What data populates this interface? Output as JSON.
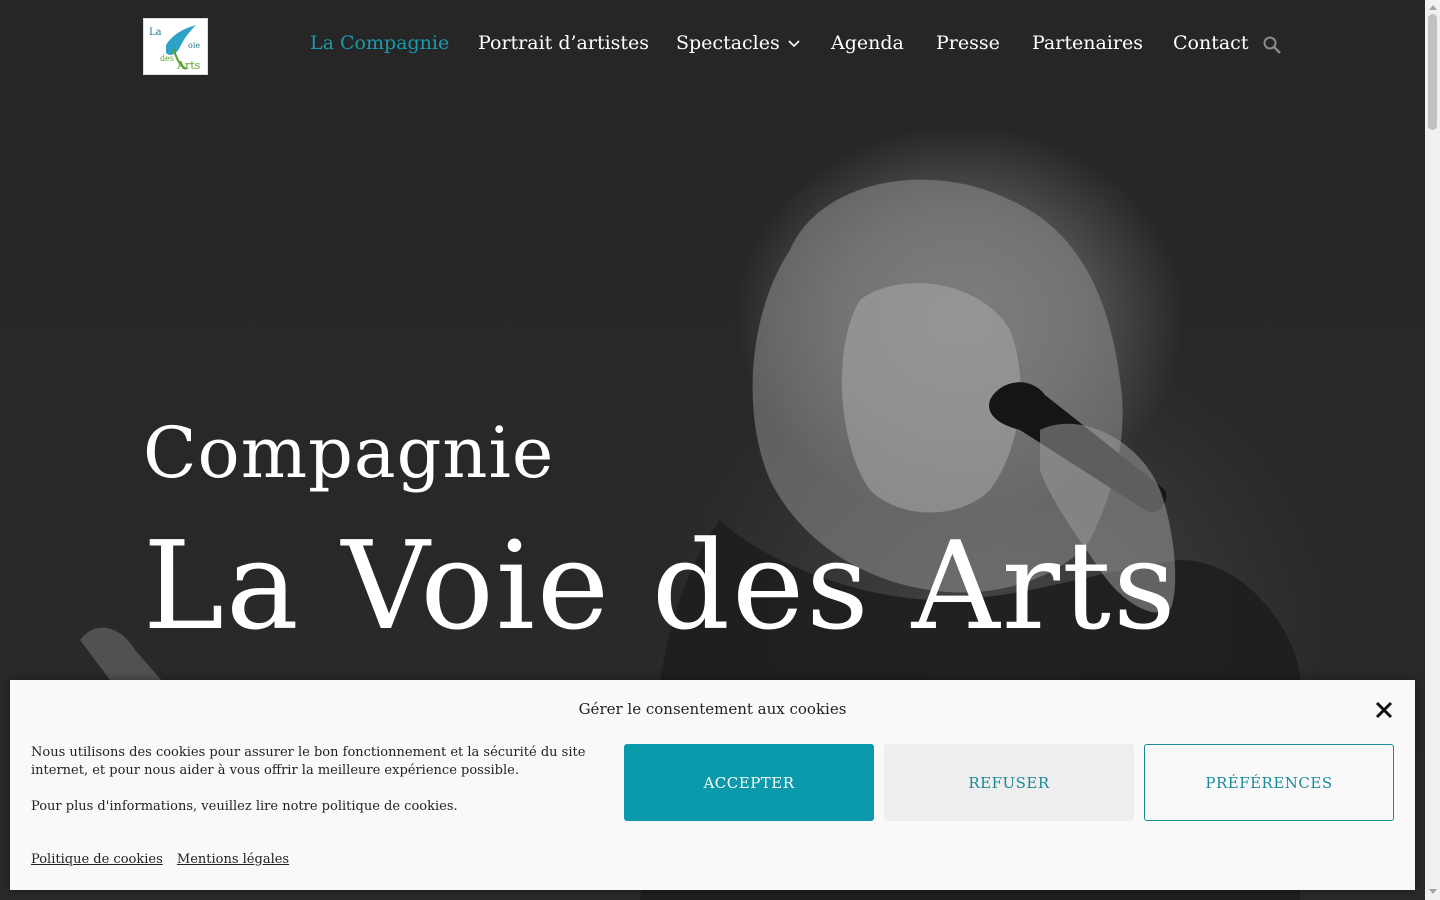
{
  "colors": {
    "accent": "#0a9aab",
    "nav_active": "#1a9aa8",
    "hero_bg": "#252525",
    "text_on_dark": "#ffffff",
    "banner_bg": "#f9f9f9"
  },
  "header": {
    "logo": {
      "line1": "La",
      "line2": "oie",
      "line3": "des",
      "line4": "Arts",
      "icon": "bird-logo-icon"
    },
    "nav": [
      {
        "label": "La Compagnie",
        "active": true
      },
      {
        "label": "Portrait d’artistes",
        "active": false
      },
      {
        "label": "Spectacles",
        "active": false,
        "has_dropdown": true
      },
      {
        "label": "Agenda",
        "active": false
      },
      {
        "label": "Presse",
        "active": false
      },
      {
        "label": "Partenaires",
        "active": false
      },
      {
        "label": "Contact",
        "active": false
      }
    ],
    "search_icon": "search-icon",
    "dropdown_icon": "chevron-down-icon"
  },
  "hero": {
    "subtitle": "Compagnie",
    "title": "La Voie des Arts"
  },
  "cookie_banner": {
    "title": "Gérer le consentement aux cookies",
    "text1": "Nous utilisons des cookies pour assurer le bon fonctionnement et la sécurité du site internet, et pour nous aider à vous offrir la meilleure expérience possible.",
    "text2": "Pour plus d'informations, veuillez lire notre politique de cookies.",
    "accept": "ACCEPTER",
    "refuse": "REFUSER",
    "preferences": "PRÉFÉRENCES",
    "links": [
      "Politique de cookies",
      "Mentions légales"
    ],
    "close_icon": "close-icon"
  }
}
